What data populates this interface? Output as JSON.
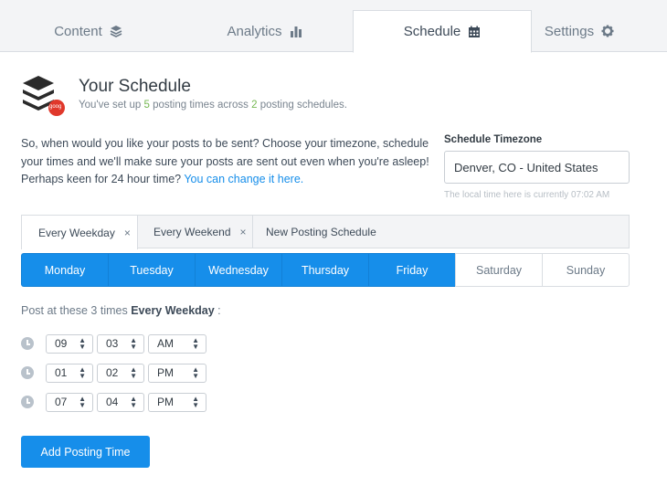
{
  "nav": {
    "tabs": [
      {
        "label": "Content",
        "icon": "layers-icon",
        "active": false
      },
      {
        "label": "Analytics",
        "icon": "bar-chart-icon",
        "active": false
      },
      {
        "label": "Schedule",
        "icon": "calendar-icon",
        "active": true
      },
      {
        "label": "Settings",
        "icon": "gear-icon",
        "active": false
      }
    ]
  },
  "header": {
    "title": "Your Schedule",
    "subtitle_pre": "You've set up ",
    "posting_times_count": "5",
    "subtitle_mid": " posting times across ",
    "schedules_count": "2",
    "subtitle_post": " posting schedules.",
    "badge_text": "goog"
  },
  "intro": {
    "text": "So, when would you like your posts to be sent? Choose your timezone, schedule your times and we'll make sure your posts are sent out even when you're asleep!",
    "hour_prompt": "Perhaps keen for 24 hour time? ",
    "hour_link": "You can change it here."
  },
  "timezone": {
    "label": "Schedule Timezone",
    "value": "Denver, CO - United States",
    "note": "The local time here is currently 07:02 AM"
  },
  "schedule_tabs": [
    {
      "label": "Every Weekday",
      "close": "×",
      "active": true
    },
    {
      "label": "Every Weekend",
      "close": "×",
      "active": false
    },
    {
      "label": "New Posting Schedule",
      "close": "",
      "active": false
    }
  ],
  "days": [
    {
      "label": "Monday",
      "on": true
    },
    {
      "label": "Tuesday",
      "on": true
    },
    {
      "label": "Wednesday",
      "on": true
    },
    {
      "label": "Thursday",
      "on": true
    },
    {
      "label": "Friday",
      "on": true
    },
    {
      "label": "Saturday",
      "on": false
    },
    {
      "label": "Sunday",
      "on": false
    }
  ],
  "posting": {
    "head_pre": "Post at these 3 times ",
    "head_bold": "Every Weekday",
    "head_post": " :",
    "times": [
      {
        "hour": "09",
        "minute": "03",
        "ampm": "AM"
      },
      {
        "hour": "01",
        "minute": "02",
        "ampm": "PM"
      },
      {
        "hour": "07",
        "minute": "04",
        "ampm": "PM"
      }
    ]
  },
  "add_button": "Add Posting Time",
  "colors": {
    "accent": "#168eea",
    "green": "#76b852",
    "badge": "#e0382b"
  }
}
